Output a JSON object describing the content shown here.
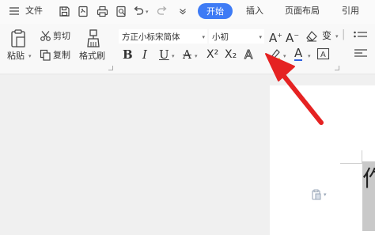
{
  "menubar": {
    "file_label": "文件",
    "tabs": [
      {
        "label": "开始",
        "active": true
      },
      {
        "label": "插入"
      },
      {
        "label": "页面布局"
      },
      {
        "label": "引用"
      }
    ]
  },
  "ribbon": {
    "cut_label": "剪切",
    "copy_label": "复制",
    "paste_label": "粘贴",
    "format_painter_label": "格式刷",
    "font_name": "方正小标宋简体",
    "font_size": "小初",
    "superscript_label": "X²",
    "subscript_label": "X₂",
    "grow_font_label": "A",
    "shrink_font_label": "A",
    "pinyin_label": "变"
  },
  "document": {
    "visible_char": "作"
  },
  "colors": {
    "accent": "#3e7bf5",
    "annotation_arrow": "#e52222",
    "font_color": "#2e5fe0"
  }
}
